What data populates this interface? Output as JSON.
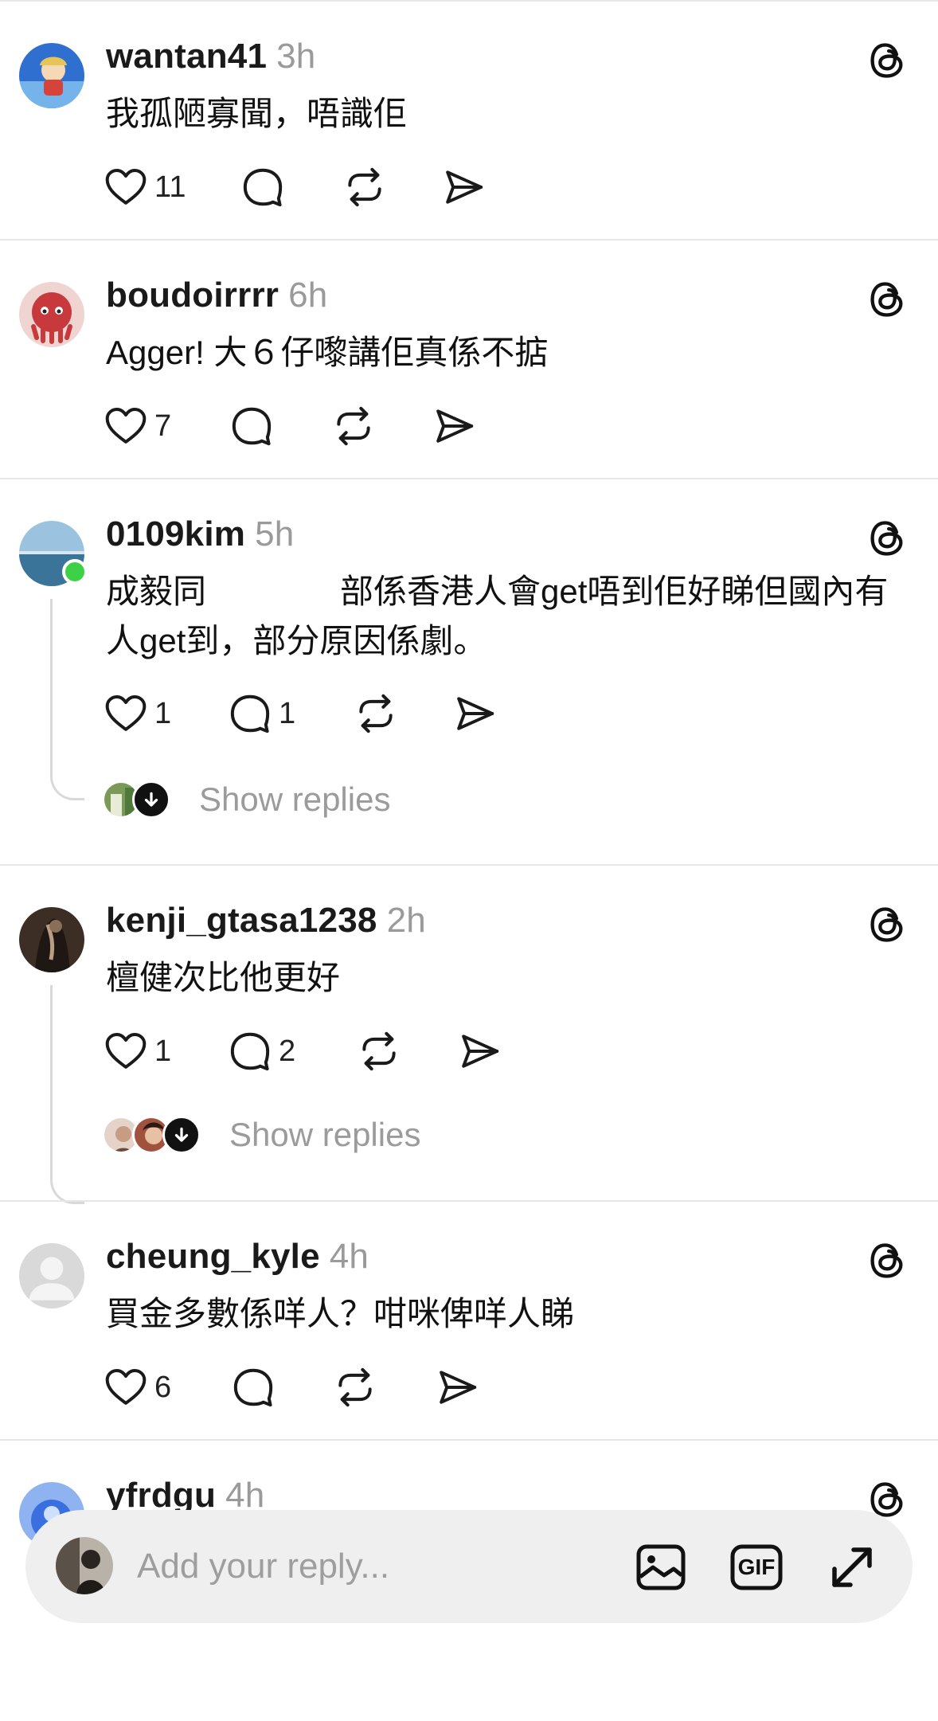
{
  "posts": [
    {
      "username": "wantan41",
      "time": "3h",
      "text": "我孤陋寡聞，唔識佢",
      "likes": "11",
      "replies_count": "",
      "avatar_color": "#2f6fd0"
    },
    {
      "username": "boudoirrrr",
      "time": "6h",
      "text": "Agger! 大６仔嚟講佢真係不掂",
      "likes": "7",
      "replies_count": "",
      "avatar_color": "#c8393d"
    },
    {
      "username": "0109kim",
      "time": "5h",
      "text": "成毅同　　　　部係香港人會get唔到佢好睇但國內有人get到，部分原因係劇。",
      "likes": "1",
      "replies_count": "1",
      "show_replies": "Show replies",
      "avatar_color": "#6a9ab8"
    },
    {
      "username": "kenji_gtasa1238",
      "time": "2h",
      "text": "檀健次比他更好",
      "likes": "1",
      "replies_count": "2",
      "show_replies": "Show replies",
      "avatar_color": "#3c2e25"
    },
    {
      "username": "cheung_kyle",
      "time": "4h",
      "text": "買金多數係咩人？咁咪俾咩人睇",
      "likes": "6",
      "replies_count": "",
      "avatar_color": "#d8d8d8"
    },
    {
      "username": "yfrdgu",
      "time": "4h",
      "text": "",
      "likes": "",
      "replies_count": "",
      "avatar_color": "#3a6fe0"
    }
  ],
  "reply_bar": {
    "placeholder": "Add your reply...",
    "gif_label": "GIF"
  },
  "icons": {
    "like": "heart-icon",
    "comment": "comment-icon",
    "repost": "repost-icon",
    "share": "send-icon",
    "threads": "threads-logo-icon",
    "photo": "image-icon",
    "gif": "gif-icon",
    "expand": "expand-icon"
  },
  "colors": {
    "online": "#3ed045",
    "muted": "#9b9b9b",
    "divider": "#e6e6e6"
  }
}
